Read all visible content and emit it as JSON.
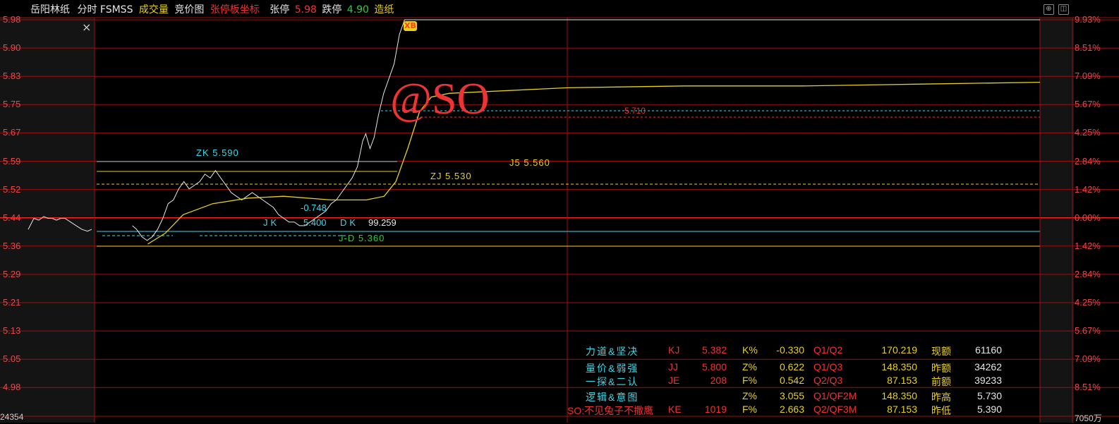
{
  "header": {
    "stock_name": "岳阳林纸",
    "mode": "分时",
    "indicator": "FSMSS",
    "volume_label": "成交量",
    "auction_label": "竞价图",
    "limit_axis_label": "张停板坐标",
    "limit_up_label": "张停",
    "limit_up_value": "5.98",
    "limit_down_label": "跌停",
    "limit_down_value": "4.90",
    "sector": "造纸"
  },
  "colors": {
    "accent_red": "#e33",
    "yellow": "#e8d020",
    "cyan": "#3dd7e8",
    "green": "#2ecc40",
    "white": "#e6e6e6"
  },
  "left_axis": [
    "5.98",
    "5.90",
    "5.83",
    "5.75",
    "5.67",
    "5.59",
    "5.52",
    "5.44",
    "5.36",
    "5.29",
    "5.21",
    "5.13",
    "5.05",
    "4.98"
  ],
  "left_axis_bottom": "24354",
  "right_axis": [
    "9.93%",
    "8.51%",
    "7.09%",
    "5.67%",
    "4.25%",
    "2.84%",
    "1.42%",
    "0.00%",
    "1.42%",
    "2.84%",
    "4.25%",
    "5.67%",
    "7.09%",
    "8.51%"
  ],
  "right_axis_bottom": "7050万",
  "close_icon": "×",
  "chart_labels": {
    "zk": "ZK 5.590",
    "zj": "ZJ  5.530",
    "j5": "J5    5.560",
    "jk": "JK",
    "jk_value": "5.400",
    "dk": "DK",
    "dk_value": "99.259",
    "jd": "J-D  5.360",
    "neg": "-0.748",
    "line_5710": "5.710",
    "watermark": "@SO",
    "marker": "XB"
  },
  "stats_rows": [
    {
      "name": "力道&坚决",
      "code": "KJ",
      "v1": "5.382",
      "k": "K%",
      "kv": "-0.330",
      "q": "Q1/Q2",
      "qv": "170.219",
      "m": "现额",
      "mv": "61160"
    },
    {
      "name": "量价&弱强",
      "code": "JJ",
      "v1": "5.800",
      "k": "Z%",
      "kv": "0.622",
      "q": "Q1/Q3",
      "qv": "148.350",
      "m": "昨额",
      "mv": "34262"
    },
    {
      "name": "一探&二认",
      "code": "JE",
      "v1": "208",
      "k": "F%",
      "kv": "0.542",
      "q": "Q2/Q3",
      "qv": "87.153",
      "m": "前额",
      "mv": "39233"
    },
    {
      "name": "逻辑&意图",
      "code": "",
      "v1": "",
      "k": "Z%",
      "kv": "3.055",
      "q": "Q1/QF2M",
      "qv": "148.350",
      "m": "昨高",
      "mv": "5.730"
    },
    {
      "name": "SO:不见兔子不撒鹰",
      "code": "KE",
      "v1": "1019",
      "k": "F%",
      "kv": "2.663",
      "q": "Q2/QF3M",
      "qv": "87.153",
      "m": "昨低",
      "mv": "5.390"
    }
  ],
  "chart_data": {
    "type": "line",
    "ylim": [
      4.98,
      5.98
    ],
    "reference_price": 5.44,
    "price_series": [
      [
        0,
        5.44
      ],
      [
        5,
        5.44
      ],
      [
        10,
        5.445
      ],
      [
        15,
        5.44
      ],
      [
        20,
        5.44
      ],
      [
        25,
        5.435
      ],
      [
        30,
        5.43
      ],
      [
        36,
        5.42
      ],
      [
        40,
        5.41
      ],
      [
        45,
        5.39
      ],
      [
        50,
        5.38
      ],
      [
        55,
        5.39
      ],
      [
        60,
        5.41
      ],
      [
        65,
        5.44
      ],
      [
        70,
        5.48
      ],
      [
        75,
        5.49
      ],
      [
        80,
        5.52
      ],
      [
        85,
        5.54
      ],
      [
        90,
        5.52
      ],
      [
        95,
        5.53
      ],
      [
        100,
        5.54
      ],
      [
        105,
        5.56
      ],
      [
        110,
        5.55
      ],
      [
        115,
        5.57
      ],
      [
        120,
        5.55
      ],
      [
        125,
        5.53
      ],
      [
        130,
        5.51
      ],
      [
        135,
        5.5
      ],
      [
        140,
        5.49
      ],
      [
        145,
        5.5
      ],
      [
        150,
        5.51
      ],
      [
        155,
        5.5
      ],
      [
        160,
        5.49
      ],
      [
        165,
        5.48
      ],
      [
        170,
        5.47
      ],
      [
        175,
        5.45
      ],
      [
        180,
        5.44
      ],
      [
        185,
        5.43
      ],
      [
        190,
        5.43
      ],
      [
        195,
        5.42
      ],
      [
        200,
        5.42
      ],
      [
        205,
        5.43
      ],
      [
        210,
        5.44
      ],
      [
        215,
        5.45
      ],
      [
        220,
        5.46
      ],
      [
        225,
        5.48
      ],
      [
        230,
        5.49
      ],
      [
        235,
        5.51
      ],
      [
        240,
        5.53
      ],
      [
        245,
        5.55
      ],
      [
        250,
        5.58
      ],
      [
        255,
        5.65
      ],
      [
        258,
        5.67
      ],
      [
        262,
        5.63
      ],
      [
        266,
        5.66
      ],
      [
        270,
        5.72
      ],
      [
        275,
        5.78
      ],
      [
        280,
        5.82
      ],
      [
        285,
        5.86
      ],
      [
        290,
        5.94
      ],
      [
        295,
        5.98
      ],
      [
        300,
        5.98
      ]
    ],
    "avg_series": [
      [
        45,
        5.37
      ],
      [
        60,
        5.4
      ],
      [
        75,
        5.45
      ],
      [
        100,
        5.48
      ],
      [
        130,
        5.495
      ],
      [
        160,
        5.5
      ],
      [
        200,
        5.49
      ],
      [
        230,
        5.49
      ],
      [
        245,
        5.5
      ],
      [
        255,
        5.54
      ],
      [
        265,
        5.63
      ],
      [
        275,
        5.73
      ],
      [
        285,
        5.77
      ],
      [
        300,
        5.78
      ],
      [
        400,
        5.795
      ],
      [
        500,
        5.8
      ],
      [
        600,
        5.8
      ],
      [
        700,
        5.805
      ],
      [
        800,
        5.81
      ]
    ]
  }
}
